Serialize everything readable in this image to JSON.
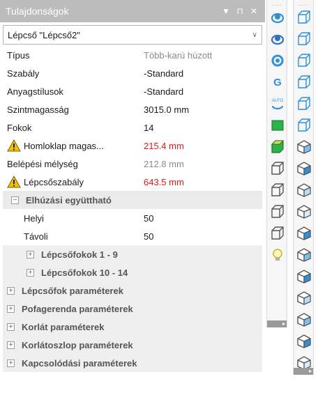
{
  "panel": {
    "title": "Tulajdonságok",
    "controls": {
      "dropdown": "▼",
      "pin": "⊓",
      "close": "✕"
    },
    "selector": {
      "value": "Lépcső \"Lépcső2\""
    }
  },
  "rows_top": [
    {
      "name": "Típus",
      "value": "Több-karú húzott",
      "tone": "gray",
      "warn": false
    },
    {
      "name": "Szabály",
      "value": "-Standard",
      "tone": "normal",
      "warn": false
    },
    {
      "name": "Anyagstílusok",
      "value": "-Standard",
      "tone": "normal",
      "warn": false
    },
    {
      "name": "Szintmagasság",
      "value": "3015.0 mm",
      "tone": "normal",
      "warn": false
    },
    {
      "name": "Fokok",
      "value": "14",
      "tone": "normal",
      "warn": false
    },
    {
      "name": "Homloklap magas...",
      "value": "215.4 mm",
      "tone": "red",
      "warn": true
    },
    {
      "name": "Belépési mélység",
      "value": "212.8 mm",
      "tone": "gray",
      "warn": false
    },
    {
      "name": "Lépcsőszabály",
      "value": "643.5 mm",
      "tone": "red",
      "warn": true
    }
  ],
  "category_drag": {
    "label": "Elhúzási együttható",
    "expander": "⊟",
    "rows": [
      {
        "name": "Helyi",
        "value": "50"
      },
      {
        "name": "Távoli",
        "value": "50"
      }
    ],
    "subcats": [
      {
        "label": "Lépcsőfokok 1 - 9",
        "expander": "⊞"
      },
      {
        "label": "Lépcsőfokok 10 - 14",
        "expander": "⊞"
      }
    ]
  },
  "categories": [
    {
      "label": "Lépcsőfok paraméterek",
      "expander": "⊞"
    },
    {
      "label": "Pofagerenda paraméterek",
      "expander": "⊞"
    },
    {
      "label": "Korlát paraméterek",
      "expander": "⊞"
    },
    {
      "label": "Korlátoszlop paraméterek",
      "expander": "⊞"
    },
    {
      "label": "Kapcsolódási paraméterek",
      "expander": "⊞"
    }
  ],
  "toolbar1": {
    "grip": "....",
    "tools": [
      "orbit-icon",
      "pan-orbit-icon",
      "rotate-icon",
      "orbit-g-icon",
      "auto-orbit-icon",
      "green-face-icon",
      "green-cube-icon",
      "box-front-icon",
      "box-side-icon",
      "box-plain-icon",
      "box-outline-icon",
      "lightbulb-icon"
    ],
    "auto_label": "AUTO",
    "foot": "▸"
  },
  "toolbar2": {
    "grip": "....",
    "tools": [
      "view-front-icon",
      "view-back-icon",
      "view-left-icon",
      "view-right-icon",
      "view-top-icon",
      "view-bottom-icon",
      "iso-sw-icon",
      "iso-se-icon",
      "iso-ne-icon",
      "iso-nw-icon",
      "iso-4-icon",
      "iso-5-icon",
      "iso-6-icon",
      "iso-7-icon",
      "iso-8-icon",
      "iso-9-icon",
      "iso-10-icon"
    ],
    "foot": "▸"
  },
  "colors": {
    "accent": "#2f8fd8",
    "warning": "#f2c200",
    "red_value": "#e01818",
    "titlebar": "#bcbcbc"
  }
}
